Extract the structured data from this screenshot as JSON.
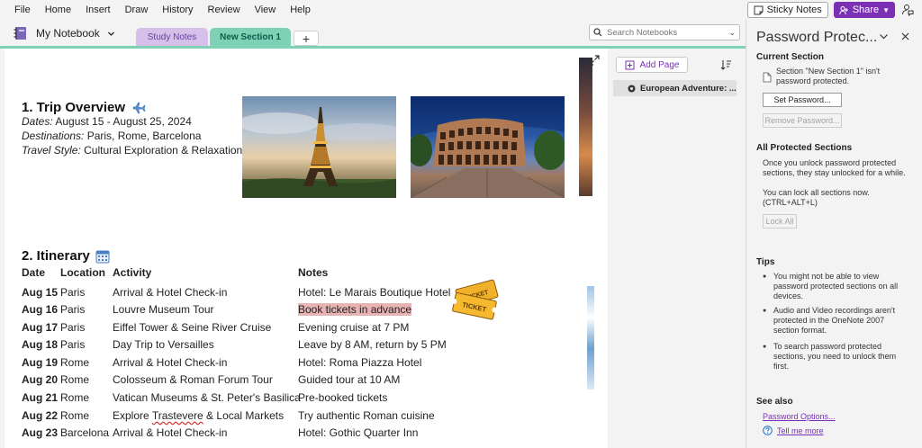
{
  "menu": [
    "File",
    "Home",
    "Insert",
    "Draw",
    "History",
    "Review",
    "View",
    "Help"
  ],
  "topbar": {
    "sticky_label": "Sticky Notes",
    "share_label": "Share"
  },
  "notebook": {
    "name": "My Notebook",
    "tabs": [
      {
        "label": "Study Notes"
      },
      {
        "label": "New Section 1"
      }
    ],
    "add_tab": "+",
    "search_placeholder": "Search Notebooks"
  },
  "page": {
    "section1_title": "1. Trip Overview",
    "dates_label": "Dates:",
    "dates_value": "August 15 - August 25, 2024",
    "dest_label": "Destinations:",
    "dest_value": "Paris, Rome, Barcelona",
    "style_label": "Travel Style:",
    "style_value": "Cultural Exploration & Relaxation",
    "section2_title": "2. Itinerary",
    "headers": {
      "date": "Date",
      "location": "Location",
      "activity": "Activity",
      "notes": "Notes"
    },
    "rows": [
      {
        "date": "Aug 15",
        "location": "Paris",
        "activity": "Arrival & Hotel Check-in",
        "notes": "Hotel: Le Marais Boutique Hotel"
      },
      {
        "date": "Aug 16",
        "location": "Paris",
        "activity": "Louvre Museum Tour",
        "notes": "Book tickets in advance"
      },
      {
        "date": "Aug 17",
        "location": "Paris",
        "activity": "Eiffel Tower & Seine River Cruise",
        "notes": "Evening cruise at 7 PM"
      },
      {
        "date": "Aug 18",
        "location": "Paris",
        "activity": "Day Trip to Versailles",
        "notes": "Leave by 8 AM, return by 5 PM"
      },
      {
        "date": "Aug 19",
        "location": "Rome",
        "activity": "Arrival & Hotel Check-in",
        "notes": "Hotel: Roma Piazza Hotel"
      },
      {
        "date": "Aug 20",
        "location": "Rome",
        "activity": "Colosseum & Roman Forum Tour",
        "notes": "Guided tour at 10 AM"
      },
      {
        "date": "Aug 21",
        "location": "Rome",
        "activity": "Vatican Museums & St. Peter's Basilica",
        "notes": "Pre-booked tickets"
      },
      {
        "date": "Aug 22",
        "location": "Rome",
        "activity_pre": "Explore ",
        "activity_wavy": "Trastevere",
        "activity_post": " & Local Markets",
        "notes": "Try authentic Roman cuisine"
      },
      {
        "date": "Aug 23",
        "location": "Barcelona",
        "activity": "Arrival & Hotel Check-in",
        "notes": "Hotel: Gothic Quarter Inn"
      }
    ],
    "ticket_text": "TICKET"
  },
  "pagelist": {
    "add_page_label": "Add Page",
    "items": [
      "European Adventure: ..."
    ]
  },
  "pane": {
    "title": "Password Protec...",
    "current_heading": "Current Section",
    "current_text": "Section \"New Section 1\" isn't password protected.",
    "set_password": "Set Password...",
    "remove_password": "Remove Password...",
    "all_heading": "All Protected Sections",
    "all_text1": "Once you unlock password protected sections, they stay unlocked for a while.",
    "all_text2": "You can lock all sections now. (CTRL+ALT+L)",
    "lock_all": "Lock All",
    "tips_heading": "Tips",
    "tips": [
      "You might not be able to view password protected sections on all devices.",
      "Audio and Video recordings aren't protected in the OneNote 2007 section format.",
      "To search password protected sections, you need to unlock them first."
    ],
    "seealso_heading": "See also",
    "password_options": "Password Options...",
    "tell_me_more": "Tell me more"
  },
  "colors": {
    "accent_purple": "#7b2fb5",
    "section_tab_green": "#7fd1b6",
    "section_tab_purple": "#d4c0e8",
    "note_highlight": "#e8b3b3"
  }
}
